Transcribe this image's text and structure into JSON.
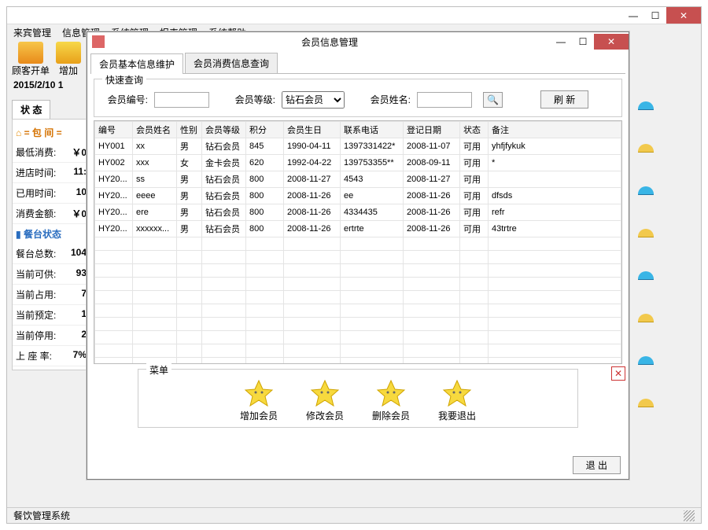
{
  "main": {
    "menus": [
      "来宾管理",
      "信息管理",
      "系统管理",
      "报表管理",
      "系统帮助"
    ],
    "toolbar": {
      "item0": "顾客开单",
      "item1": "增加"
    },
    "datetime": "2015/2/10  1",
    "status_tab": "状 态",
    "section_room": "= 包 间 =",
    "rows": {
      "min": {
        "label": "最低消费:",
        "value": "￥0"
      },
      "enter": {
        "label": "进店时间:",
        "value": "11:"
      },
      "used": {
        "label": "已用时间:",
        "value": "10"
      },
      "amount": {
        "label": "消费金额:",
        "value": "￥0"
      }
    },
    "section_table": "餐台状态",
    "stats": {
      "total": {
        "label": "餐台总数:",
        "value": "104"
      },
      "avail": {
        "label": "当前可供:",
        "value": "93"
      },
      "busy": {
        "label": "当前占用:",
        "value": "7"
      },
      "rsv": {
        "label": "当前预定:",
        "value": "1"
      },
      "stop": {
        "label": "当前停用:",
        "value": "2"
      },
      "rate": {
        "label": "上 座 率:",
        "value": "7%"
      }
    },
    "status_text": "餐饮管理系统"
  },
  "dialog": {
    "title": "会员信息管理",
    "tabs": [
      "会员基本信息维护",
      "会员消费信息查询"
    ],
    "quick": {
      "legend": "快速查询",
      "id_label": "会员编号:",
      "level_label": "会员等级:",
      "level_value": "钻石会员",
      "name_label": "会员姓名:",
      "refresh": "刷 新"
    },
    "columns": [
      "编号",
      "会员姓名",
      "性别",
      "会员等级",
      "积分",
      "会员生日",
      "联系电话",
      "登记日期",
      "状态",
      "备注"
    ],
    "rows": [
      {
        "id": "HY001",
        "name": "xx",
        "sex": "男",
        "level": "钻石会员",
        "points": "845",
        "birth": "1990-04-11",
        "phone": "1397331422*",
        "reg": "2008-11-07",
        "status": "可用",
        "note": "yhfjfykuk"
      },
      {
        "id": "HY002",
        "name": "xxx",
        "sex": "女",
        "level": "金卡会员",
        "points": "620",
        "birth": "1992-04-22",
        "phone": "139753355**",
        "reg": "2008-09-11",
        "status": "可用",
        "note": "*"
      },
      {
        "id": "HY20...",
        "name": "ss",
        "sex": "男",
        "level": "钻石会员",
        "points": "800",
        "birth": "2008-11-27",
        "phone": "4543",
        "reg": "2008-11-27",
        "status": "可用",
        "note": ""
      },
      {
        "id": "HY20...",
        "name": "eeee",
        "sex": "男",
        "level": "钻石会员",
        "points": "800",
        "birth": "2008-11-26",
        "phone": "ee",
        "reg": "2008-11-26",
        "status": "可用",
        "note": "dfsds"
      },
      {
        "id": "HY20...",
        "name": "ere",
        "sex": "男",
        "level": "钻石会员",
        "points": "800",
        "birth": "2008-11-26",
        "phone": "4334435",
        "reg": "2008-11-26",
        "status": "可用",
        "note": "refr"
      },
      {
        "id": "HY20...",
        "name": "xxxxxx...",
        "sex": "男",
        "level": "钻石会员",
        "points": "800",
        "birth": "2008-11-26",
        "phone": "ertrte",
        "reg": "2008-11-26",
        "status": "可用",
        "note": "43trtre"
      }
    ],
    "menu": {
      "legend": "菜单",
      "add": "增加会员",
      "edit": "修改会员",
      "del": "删除会员",
      "exit": "我要退出"
    },
    "footer_exit": "退 出"
  }
}
